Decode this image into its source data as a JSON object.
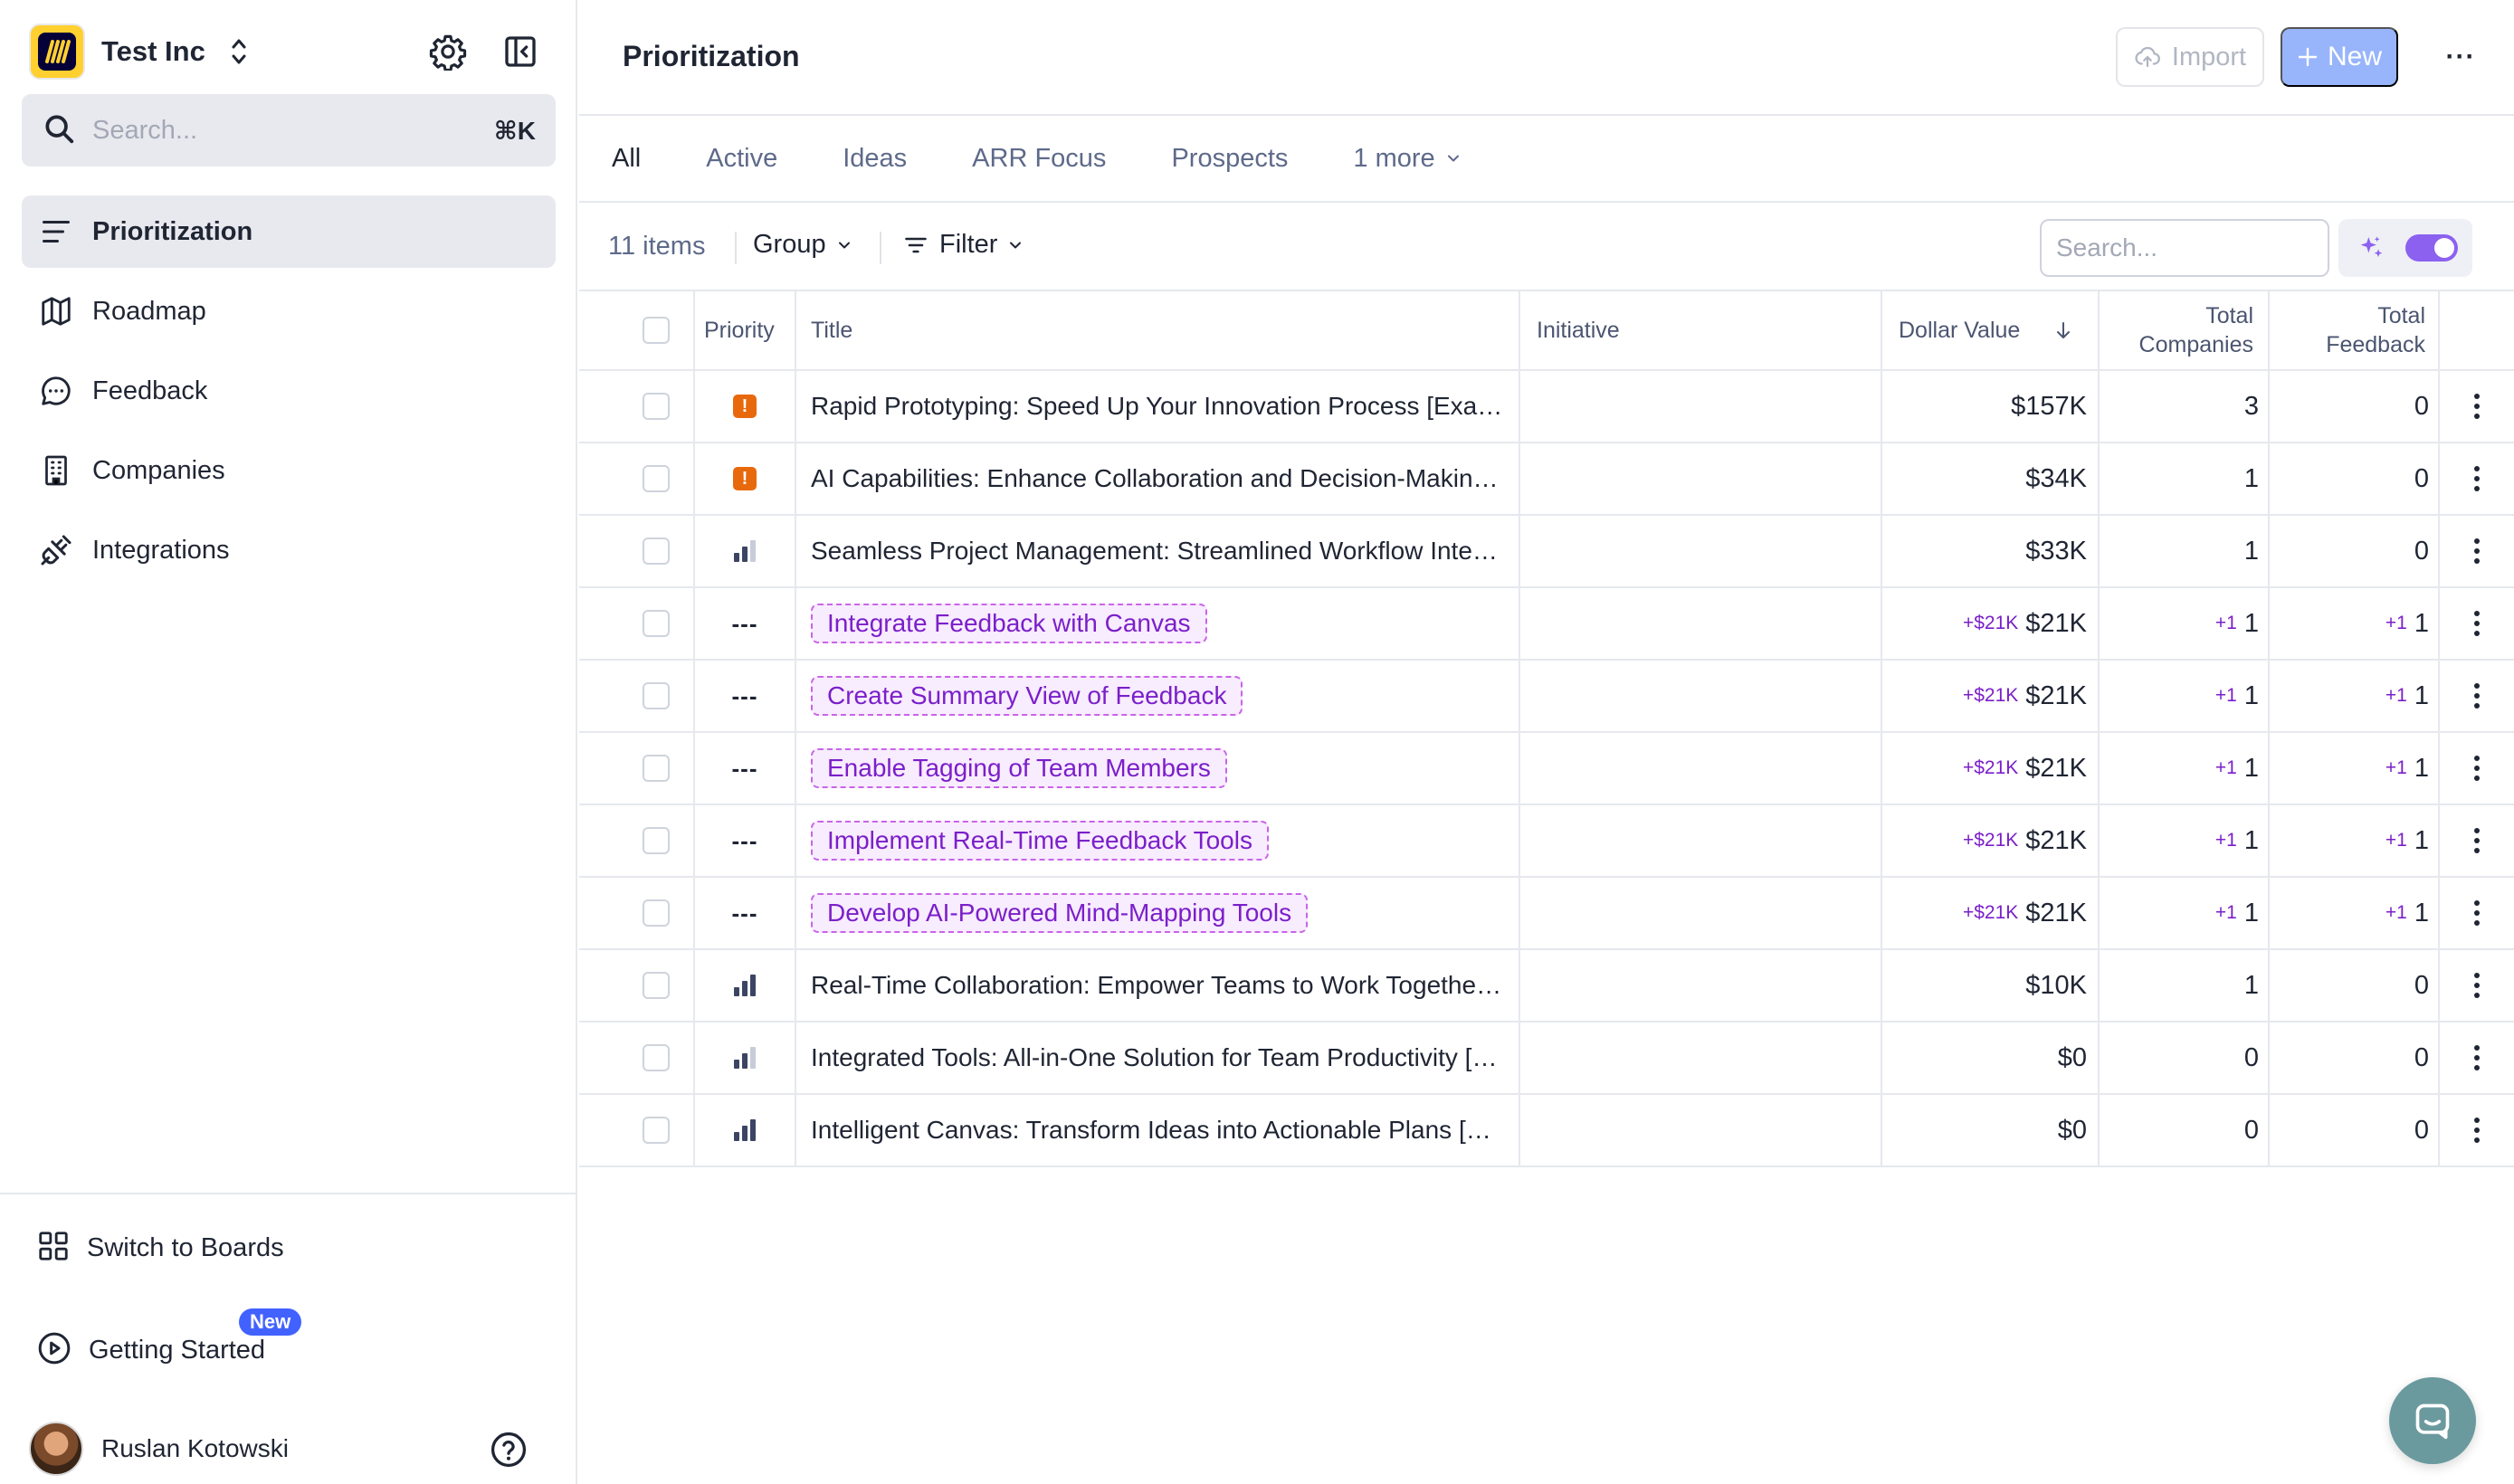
{
  "workspace": {
    "name": "Test Inc"
  },
  "sidebar": {
    "search": {
      "placeholder": "Search...",
      "shortcut": "⌘K"
    },
    "nav": [
      {
        "label": "Prioritization",
        "icon": "list-icon",
        "active": true
      },
      {
        "label": "Roadmap",
        "icon": "map-icon",
        "active": false
      },
      {
        "label": "Feedback",
        "icon": "chat-bubble-icon",
        "active": false
      },
      {
        "label": "Companies",
        "icon": "building-icon",
        "active": false
      },
      {
        "label": "Integrations",
        "icon": "plug-icon",
        "active": false
      }
    ],
    "bottom": {
      "switch_label": "Switch to Boards",
      "getting_started_label": "Getting Started",
      "new_badge": "New"
    },
    "user": {
      "name": "Ruslan Kotowski"
    }
  },
  "header": {
    "title": "Prioritization",
    "import_label": "Import",
    "new_label": "New",
    "more_label": "···"
  },
  "tabs": [
    {
      "label": "All",
      "active": true
    },
    {
      "label": "Active",
      "active": false
    },
    {
      "label": "Ideas",
      "active": false
    },
    {
      "label": "ARR Focus",
      "active": false
    },
    {
      "label": "Prospects",
      "active": false
    },
    {
      "label": "1 more",
      "active": false,
      "dropdown": true
    }
  ],
  "toolbar": {
    "count": "11 items",
    "group_label": "Group",
    "filter_label": "Filter",
    "search_placeholder": "Search..."
  },
  "table": {
    "columns": {
      "priority": "Priority",
      "title": "Title",
      "initiative": "Initiative",
      "dollar_value": "Dollar Value",
      "total_companies_1": "Total",
      "total_companies_2": "Companies",
      "total_feedback_1": "Total",
      "total_feedback_2": "Feedback"
    },
    "rows": [
      {
        "priority": "urgent",
        "title": "Rapid Prototyping: Speed Up Your Innovation Process [Examp...",
        "idea": false,
        "initiative": "",
        "dollar_delta": "",
        "dollar": "$157K",
        "companies_delta": "",
        "companies": "3",
        "feedback_delta": "",
        "feedback": "0"
      },
      {
        "priority": "urgent",
        "title": "AI Capabilities: Enhance Collaboration and Decision-Making [...",
        "idea": false,
        "initiative": "",
        "dollar_delta": "",
        "dollar": "$34K",
        "companies_delta": "",
        "companies": "1",
        "feedback_delta": "",
        "feedback": "0"
      },
      {
        "priority": "medium",
        "title": "Seamless Project Management: Streamlined Workflow Integr...",
        "idea": false,
        "initiative": "",
        "dollar_delta": "",
        "dollar": "$33K",
        "companies_delta": "",
        "companies": "1",
        "feedback_delta": "",
        "feedback": "0"
      },
      {
        "priority": "none",
        "title": "Integrate Feedback with Canvas",
        "idea": true,
        "initiative": "",
        "dollar_delta": "+$21K",
        "dollar": "$21K",
        "companies_delta": "+1",
        "companies": "1",
        "feedback_delta": "+1",
        "feedback": "1"
      },
      {
        "priority": "none",
        "title": "Create Summary View of Feedback",
        "idea": true,
        "initiative": "",
        "dollar_delta": "+$21K",
        "dollar": "$21K",
        "companies_delta": "+1",
        "companies": "1",
        "feedback_delta": "+1",
        "feedback": "1"
      },
      {
        "priority": "none",
        "title": "Enable Tagging of Team Members",
        "idea": true,
        "initiative": "",
        "dollar_delta": "+$21K",
        "dollar": "$21K",
        "companies_delta": "+1",
        "companies": "1",
        "feedback_delta": "+1",
        "feedback": "1"
      },
      {
        "priority": "none",
        "title": "Implement Real-Time Feedback Tools",
        "idea": true,
        "initiative": "",
        "dollar_delta": "+$21K",
        "dollar": "$21K",
        "companies_delta": "+1",
        "companies": "1",
        "feedback_delta": "+1",
        "feedback": "1"
      },
      {
        "priority": "none",
        "title": "Develop AI-Powered Mind-Mapping Tools",
        "idea": true,
        "initiative": "",
        "dollar_delta": "+$21K",
        "dollar": "$21K",
        "companies_delta": "+1",
        "companies": "1",
        "feedback_delta": "+1",
        "feedback": "1"
      },
      {
        "priority": "high",
        "title": "Real-Time Collaboration: Empower Teams to Work Together E...",
        "idea": false,
        "initiative": "",
        "dollar_delta": "",
        "dollar": "$10K",
        "companies_delta": "",
        "companies": "1",
        "feedback_delta": "",
        "feedback": "0"
      },
      {
        "priority": "medium",
        "title": "Integrated Tools: All-in-One Solution for Team Productivity [E...",
        "idea": false,
        "initiative": "",
        "dollar_delta": "",
        "dollar": "$0",
        "companies_delta": "",
        "companies": "0",
        "feedback_delta": "",
        "feedback": "0"
      },
      {
        "priority": "high",
        "title": "Intelligent Canvas: Transform Ideas into Actionable Plans [Exa...",
        "idea": false,
        "initiative": "",
        "dollar_delta": "",
        "dollar": "$0",
        "companies_delta": "",
        "companies": "0",
        "feedback_delta": "",
        "feedback": "0"
      }
    ]
  },
  "colors": {
    "accent_new_button": "#98b5fb",
    "idea_purple": "#7b1fc9",
    "urgent_orange": "#e8690c",
    "toggle_purple": "#8c61f0",
    "chat_fab": "#6b9a9e"
  }
}
